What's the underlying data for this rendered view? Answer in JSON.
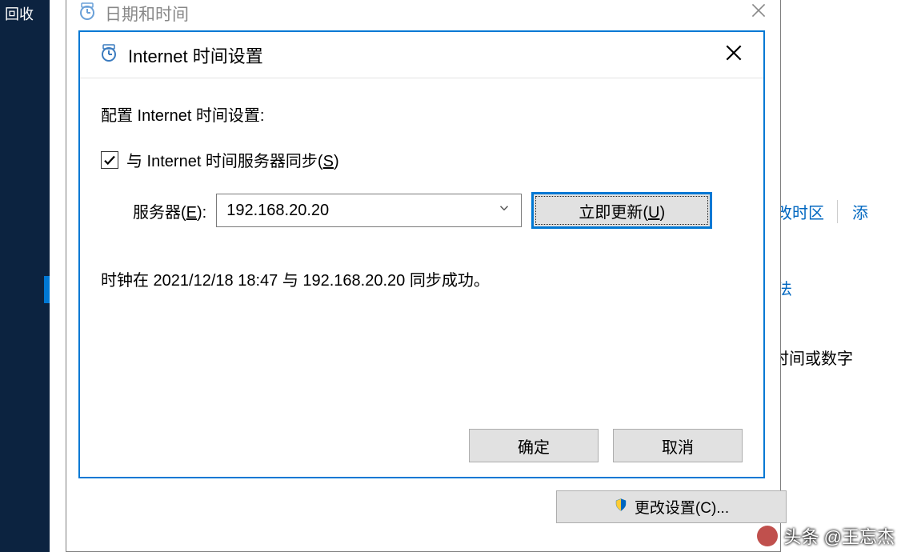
{
  "desktop": {
    "recycle_label": "回收"
  },
  "parent_dialog": {
    "title": "日期和时间",
    "change_settings_btn": "更改设置(C)..."
  },
  "bg_links": {
    "change_tz": "改时区",
    "add": "添",
    "method": "法",
    "other": "、时间或数字"
  },
  "dialog": {
    "title": "Internet 时间设置",
    "config_label": "配置 Internet 时间设置:",
    "sync_checkbox_label_pre": "与 Internet 时间服务器同步(",
    "sync_checkbox_key": "S",
    "sync_checkbox_label_post": ")",
    "server_label_pre": "服务器(",
    "server_label_key": "E",
    "server_label_post": "):",
    "server_value": "192.168.20.20",
    "update_btn_pre": "立即更新(",
    "update_btn_key": "U",
    "update_btn_post": ")",
    "status_text": "时钟在 2021/12/18 18:47 与 192.168.20.20 同步成功。",
    "ok_btn": "确定",
    "cancel_btn": "取消"
  },
  "watermark": {
    "text": "头条 @王忘杰"
  }
}
